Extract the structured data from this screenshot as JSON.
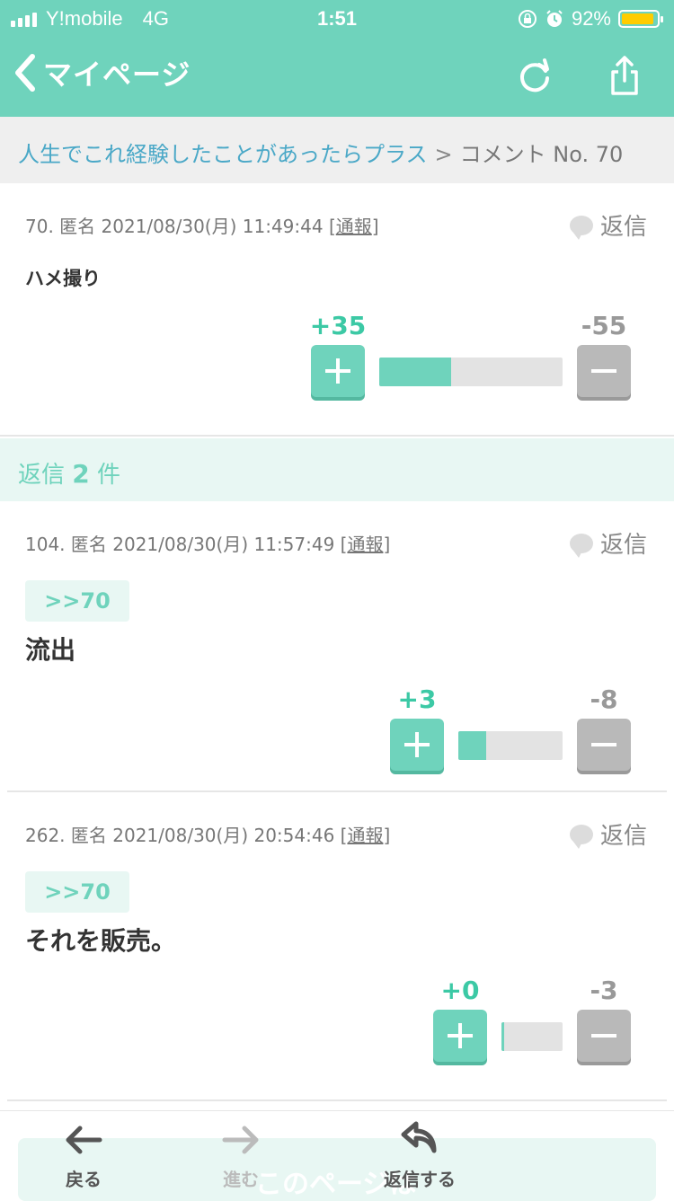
{
  "status_bar": {
    "carrier": "Y!mobile",
    "network": "4G",
    "time": "1:51",
    "battery_percent": "92%",
    "battery_level": 0.92
  },
  "nav": {
    "back_label": "マイページ",
    "icons": [
      "refresh-icon",
      "share-icon"
    ]
  },
  "breadcrumb": {
    "topic": "人生でこれ経験したことがあったらプラス",
    "separator": ">",
    "current": "コメント No. 70"
  },
  "main_comment": {
    "meta_prefix": "70. 匿名 2021/08/30(月) 11:49:44 [",
    "report": "通報",
    "meta_suffix": "]",
    "reply_label": "返信",
    "body": "ハメ撮り",
    "plus": "+35",
    "minus": "-55",
    "ratio": 0.39
  },
  "replies_header": {
    "prefix": "返信",
    "count": "2",
    "suffix": "件"
  },
  "replies": [
    {
      "meta_prefix": "104. 匿名 2021/08/30(月) 11:57:49 [",
      "report": "通報",
      "meta_suffix": "]",
      "reply_label": "返信",
      "anchor": ">>70",
      "body": "流出",
      "plus": "+3",
      "minus": "-8",
      "ratio": 0.27
    },
    {
      "meta_prefix": "262. 匿名 2021/08/30(月) 20:54:46 [",
      "report": "通報",
      "meta_suffix": "]",
      "reply_label": "返信",
      "anchor": ">>70",
      "body": "それを販売。",
      "plus": "+0",
      "minus": "-3",
      "ratio": 0.04
    }
  ],
  "bottom_bar": {
    "back_label": "戻る",
    "forward_label": "進む",
    "reply_label": "返信する",
    "toast_text": "このページは"
  },
  "colors": {
    "accent": "#6fd3bc",
    "link": "#4aa8c7",
    "battery": "#ffcc00"
  }
}
